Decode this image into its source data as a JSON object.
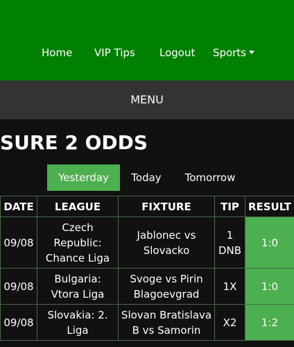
{
  "nav": {
    "home": "Home",
    "vip_tips": "VIP Tips",
    "logout": "Logout",
    "sports": "Sports",
    "sports_icon": "caret-down-icon"
  },
  "menu": {
    "label": "MENU"
  },
  "page": {
    "title": "SURE 2 ODDS"
  },
  "tabs": [
    {
      "label": "Yesterday",
      "active": true
    },
    {
      "label": "Today",
      "active": false
    },
    {
      "label": "Tomorrow",
      "active": false
    }
  ],
  "table": {
    "headers": [
      "DATE",
      "LEAGUE",
      "FIXTURE",
      "TIP",
      "RESULT"
    ],
    "rows": [
      {
        "date": "09/08",
        "league": "Czech Republic: Chance Liga",
        "fixture": "Jablonec vs Slovacko",
        "tip": "1 DNB",
        "result": "1:0"
      },
      {
        "date": "09/08",
        "league": "Bulgaria: Vtora Liga",
        "fixture": "Svoge vs Pirin Blagoevgrad",
        "tip": "1X",
        "result": "1:0"
      },
      {
        "date": "09/08",
        "league": "Slovakia: 2. Liga",
        "fixture": "Slovan Bratislava B vs Samorin",
        "tip": "X2",
        "result": "1:2"
      }
    ]
  },
  "colors": {
    "header_green": "#008000",
    "menu_bar": "#333333",
    "background": "#111111",
    "accent_green": "#4caf50",
    "table_border": "#4a6b4a"
  }
}
